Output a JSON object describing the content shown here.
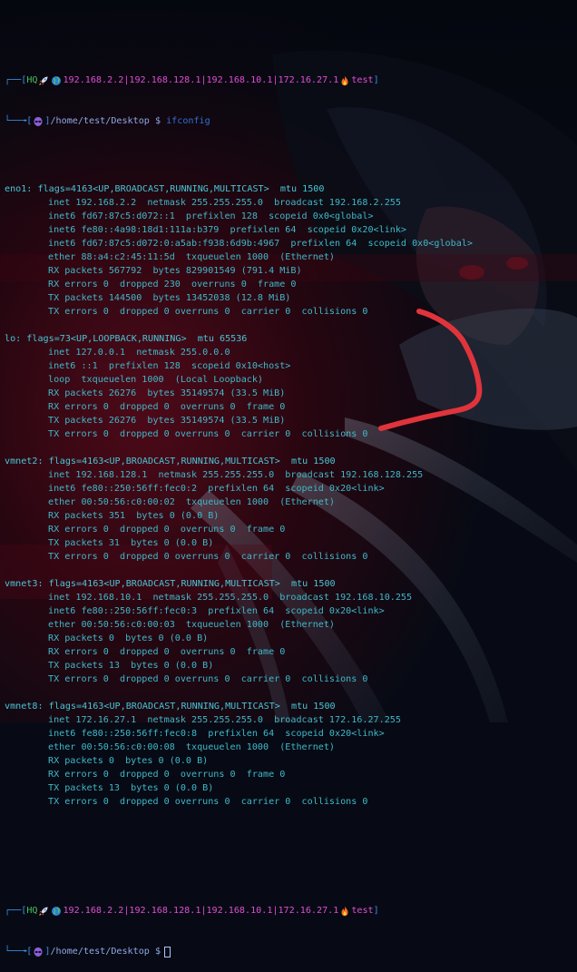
{
  "prompt": {
    "hq": "HQ",
    "ips": "192.168.2.2|192.168.128.1|192.168.10.1|172.16.27.1",
    "host": "test",
    "path": "/home/test/Desktop",
    "symbol": "$",
    "command": "ifconfig"
  },
  "prompt2": {
    "hq": "HQ",
    "ips": "192.168.2.2|192.168.128.1|192.168.10.1|172.16.27.1",
    "host": "test",
    "path": "/home/test/Desktop",
    "symbol": "$"
  },
  "icons": {
    "rocket": "rocket-icon",
    "globe": "globe-icon",
    "flame": "fire-icon",
    "skull": "alien-icon"
  },
  "colors": {
    "frame": "#3a8ee6",
    "ips": "#e04dd3",
    "output": "#3fb8c9",
    "scribble": "#e0343c"
  },
  "output": [
    {
      "text": "eno1: flags=4163<UP,BROADCAST,RUNNING,MULTICAST>  mtu 1500",
      "indent": false
    },
    {
      "text": "inet 192.168.2.2  netmask 255.255.255.0  broadcast 192.168.2.255",
      "indent": true
    },
    {
      "text": "inet6 fd67:87c5:d072::1  prefixlen 128  scopeid 0x0<global>",
      "indent": true
    },
    {
      "text": "inet6 fe80::4a98:18d1:111a:b379  prefixlen 64  scopeid 0x20<link>",
      "indent": true
    },
    {
      "text": "inet6 fd67:87c5:d072:0:a5ab:f938:6d9b:4967  prefixlen 64  scopeid 0x0<global>",
      "indent": true
    },
    {
      "text": "ether 88:a4:c2:45:11:5d  txqueuelen 1000  (Ethernet)",
      "indent": true
    },
    {
      "text": "RX packets 567792  bytes 829901549 (791.4 MiB)",
      "indent": true
    },
    {
      "text": "RX errors 0  dropped 230  overruns 0  frame 0",
      "indent": true
    },
    {
      "text": "TX packets 144500  bytes 13452038 (12.8 MiB)",
      "indent": true
    },
    {
      "text": "TX errors 0  dropped 0 overruns 0  carrier 0  collisions 0",
      "indent": true
    },
    {
      "text": "",
      "indent": false
    },
    {
      "text": "lo: flags=73<UP,LOOPBACK,RUNNING>  mtu 65536",
      "indent": false
    },
    {
      "text": "inet 127.0.0.1  netmask 255.0.0.0",
      "indent": true
    },
    {
      "text": "inet6 ::1  prefixlen 128  scopeid 0x10<host>",
      "indent": true
    },
    {
      "text": "loop  txqueuelen 1000  (Local Loopback)",
      "indent": true
    },
    {
      "text": "RX packets 26276  bytes 35149574 (33.5 MiB)",
      "indent": true
    },
    {
      "text": "RX errors 0  dropped 0  overruns 0  frame 0",
      "indent": true
    },
    {
      "text": "TX packets 26276  bytes 35149574 (33.5 MiB)",
      "indent": true
    },
    {
      "text": "TX errors 0  dropped 0 overruns 0  carrier 0  collisions 0",
      "indent": true
    },
    {
      "text": "",
      "indent": false
    },
    {
      "text": "vmnet2: flags=4163<UP,BROADCAST,RUNNING,MULTICAST>  mtu 1500",
      "indent": false
    },
    {
      "text": "inet 192.168.128.1  netmask 255.255.255.0  broadcast 192.168.128.255",
      "indent": true
    },
    {
      "text": "inet6 fe80::250:56ff:fec0:2  prefixlen 64  scopeid 0x20<link>",
      "indent": true
    },
    {
      "text": "ether 00:50:56:c0:00:02  txqueuelen 1000  (Ethernet)",
      "indent": true
    },
    {
      "text": "RX packets 351  bytes 0 (0.0 B)",
      "indent": true
    },
    {
      "text": "RX errors 0  dropped 0  overruns 0  frame 0",
      "indent": true
    },
    {
      "text": "TX packets 31  bytes 0 (0.0 B)",
      "indent": true
    },
    {
      "text": "TX errors 0  dropped 0 overruns 0  carrier 0  collisions 0",
      "indent": true
    },
    {
      "text": "",
      "indent": false
    },
    {
      "text": "vmnet3: flags=4163<UP,BROADCAST,RUNNING,MULTICAST>  mtu 1500",
      "indent": false
    },
    {
      "text": "inet 192.168.10.1  netmask 255.255.255.0  broadcast 192.168.10.255",
      "indent": true
    },
    {
      "text": "inet6 fe80::250:56ff:fec0:3  prefixlen 64  scopeid 0x20<link>",
      "indent": true
    },
    {
      "text": "ether 00:50:56:c0:00:03  txqueuelen 1000  (Ethernet)",
      "indent": true
    },
    {
      "text": "RX packets 0  bytes 0 (0.0 B)",
      "indent": true
    },
    {
      "text": "RX errors 0  dropped 0  overruns 0  frame 0",
      "indent": true
    },
    {
      "text": "TX packets 13  bytes 0 (0.0 B)",
      "indent": true
    },
    {
      "text": "TX errors 0  dropped 0 overruns 0  carrier 0  collisions 0",
      "indent": true
    },
    {
      "text": "",
      "indent": false
    },
    {
      "text": "vmnet8: flags=4163<UP,BROADCAST,RUNNING,MULTICAST>  mtu 1500",
      "indent": false
    },
    {
      "text": "inet 172.16.27.1  netmask 255.255.255.0  broadcast 172.16.27.255",
      "indent": true
    },
    {
      "text": "inet6 fe80::250:56ff:fec0:8  prefixlen 64  scopeid 0x20<link>",
      "indent": true
    },
    {
      "text": "ether 00:50:56:c0:00:08  txqueuelen 1000  (Ethernet)",
      "indent": true
    },
    {
      "text": "RX packets 0  bytes 0 (0.0 B)",
      "indent": true
    },
    {
      "text": "RX errors 0  dropped 0  overruns 0  frame 0",
      "indent": true
    },
    {
      "text": "TX packets 13  bytes 0 (0.0 B)",
      "indent": true
    },
    {
      "text": "TX errors 0  dropped 0 overruns 0  carrier 0  collisions 0",
      "indent": true
    }
  ]
}
